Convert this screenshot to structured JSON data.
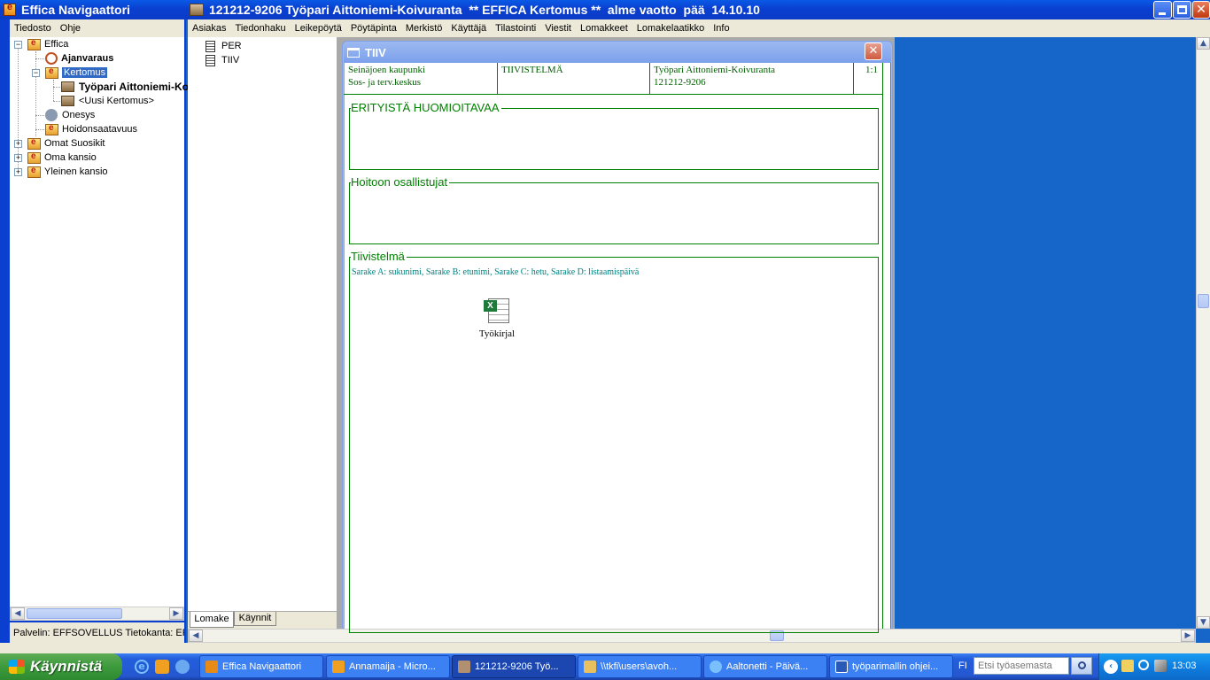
{
  "navigator": {
    "title": "Effica Navigaattori",
    "menu": [
      "Tiedosto",
      "Ohje"
    ],
    "tree": [
      {
        "label": "Effica"
      },
      {
        "label": "Ajanvaraus"
      },
      {
        "label": "Kertomus"
      },
      {
        "label": "Työpari Aittoniemi-Ko"
      },
      {
        "label": "<Uusi Kertomus>"
      },
      {
        "label": "Onesys"
      },
      {
        "label": "Hoidonsaatavuus"
      },
      {
        "label": "Omat Suosikit"
      },
      {
        "label": "Oma kansio"
      },
      {
        "label": "Yleinen kansio"
      }
    ],
    "status": "Palvelin: EFFSOVELLUS  Tietokanta: EF"
  },
  "kertomus": {
    "title": "121212-9206 Työpari Aittoniemi-Koivuranta  ** EFFICA Kertomus **  alme vaotto  pää  14.10.10",
    "menu": [
      "Asiakas",
      "Tiedonhaku",
      "Leikepöytä",
      "Pöytäpinta",
      "Merkistö",
      "Käyttäjä",
      "Tilastointi",
      "Viestit",
      "Lomakkeet",
      "Lomakelaatikko",
      "Info"
    ],
    "forms": [
      "PER",
      "TIIV"
    ],
    "bottom_tabs": [
      "Lomake",
      "Käynnit"
    ]
  },
  "tiiv": {
    "title": "TIIV",
    "header": {
      "org1": "Seinäjoen kaupunki",
      "org2": "Sos- ja terv.keskus",
      "form": "TIIVISTELMÄ",
      "patient": "Työpari Aittoniemi-Koivuranta",
      "ssn": "121212-9206",
      "page": "1:1"
    },
    "sections": [
      {
        "title": "ERITYISTÄ HUOMIOITAVAA",
        "content": ""
      },
      {
        "title": "Hoitoon osallistujat",
        "content": ""
      },
      {
        "title": "Tiivistelmä",
        "content": "Sarake A: sukunimi, Sarake B: etunimi, Sarake C: hetu, Sarake D: listaamispäivä"
      }
    ],
    "attachment": {
      "label": "Työkirjal",
      "icon": "excel-icon"
    }
  },
  "taskbar": {
    "start": "Käynnistä",
    "tasks": [
      "Effica Navigaattori",
      "Annamaija - Micro...",
      "121212-9206 Työ...",
      "\\\\tkfi\\users\\avoh...",
      "Aaltonetti - Päivä...",
      "työparimallin ohjei..."
    ],
    "lang": "FI",
    "search_placeholder": "Etsi työasemasta",
    "clock": "13:03"
  },
  "colors": {
    "titlebar": "#0a46d8",
    "desktop": "#1566c8",
    "green": "#008000",
    "taskbar": "#245edb",
    "start": "#3c9a3c"
  }
}
